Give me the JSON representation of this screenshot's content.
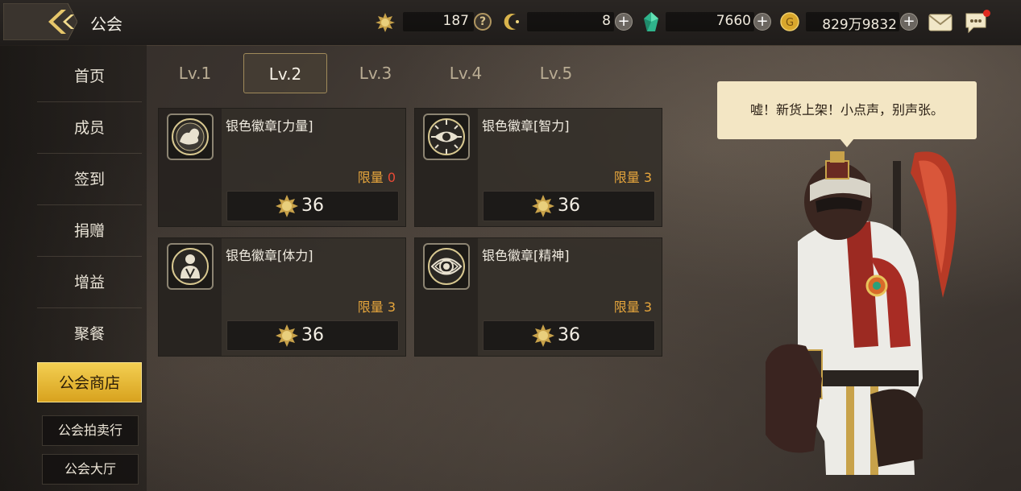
{
  "header": {
    "title": "公会",
    "resources": [
      {
        "icon": "guild-medal-icon",
        "value": "187",
        "action": "help"
      },
      {
        "icon": "crescent-coin-icon",
        "value": "8",
        "action": "add"
      },
      {
        "icon": "green-gem-icon",
        "value": "7660",
        "action": "add"
      },
      {
        "icon": "gold-coin-icon",
        "value": "829万9832",
        "action": "add"
      }
    ],
    "help_symbol": "?",
    "plus_symbol": "+"
  },
  "sidebar": {
    "items": [
      {
        "label": "首页"
      },
      {
        "label": "成员"
      },
      {
        "label": "签到"
      },
      {
        "label": "捐赠"
      },
      {
        "label": "增益"
      },
      {
        "label": "聚餐"
      }
    ],
    "active_item": {
      "label": "公会商店"
    },
    "sub_items": [
      {
        "label": "公会拍卖行"
      },
      {
        "label": "公会大厅"
      }
    ]
  },
  "tabs": [
    {
      "label": "Lv.1",
      "active": false
    },
    {
      "label": "Lv.2",
      "active": true
    },
    {
      "label": "Lv.3",
      "active": false
    },
    {
      "label": "Lv.4",
      "active": false
    },
    {
      "label": "Lv.5",
      "active": false
    }
  ],
  "shop_items": [
    {
      "name": "银色徽章[力量]",
      "limit_label": "限量",
      "limit_value": "0",
      "price": "36",
      "icon": "strength-emblem-icon"
    },
    {
      "name": "银色徽章[智力]",
      "limit_label": "限量",
      "limit_value": "3",
      "price": "36",
      "icon": "intelligence-eye-emblem-icon"
    },
    {
      "name": "银色徽章[体力]",
      "limit_label": "限量",
      "limit_value": "3",
      "price": "36",
      "icon": "vitality-figure-emblem-icon"
    },
    {
      "name": "银色徽章[精神]",
      "limit_label": "限量",
      "limit_value": "3",
      "price": "36",
      "icon": "spirit-eye-emblem-icon"
    }
  ],
  "npc": {
    "speech": "嘘！新货上架！小点声，别声张。"
  },
  "colors": {
    "accent_gold": "#f3cf52",
    "limit_orange": "#e7a63c",
    "limit_zero_red": "#e84a36",
    "bubble_bg": "#f3e6c4"
  }
}
